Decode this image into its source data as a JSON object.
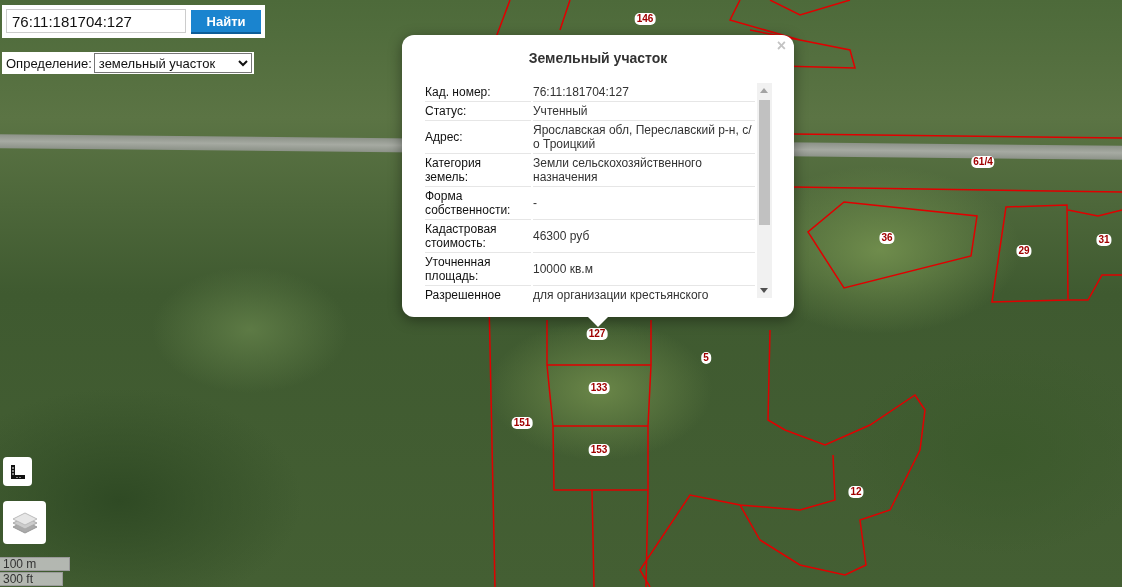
{
  "search": {
    "value": "76:11:181704:127",
    "button": "Найти"
  },
  "definition": {
    "label": "Определение:",
    "value": "земельный участок"
  },
  "popup": {
    "title": "Земельный участок",
    "close": "×",
    "rows": [
      {
        "label": "Кад. номер:",
        "value": "76:11:181704:127"
      },
      {
        "label": "Статус:",
        "value": "Учтенный"
      },
      {
        "label": "Адрес:",
        "value": "Ярославская обл, Переславский р-н, с/о Троицкий"
      },
      {
        "label": "Категория земель:",
        "value": "Земли сельскохозяйственного назначения"
      },
      {
        "label": "Форма собственности:",
        "value": "-"
      },
      {
        "label": "Кадастровая стоимость:",
        "value": "46300 руб"
      },
      {
        "label": "Уточненная площадь:",
        "value": "10000 кв.м"
      },
      {
        "label": "Разрешенное",
        "value": "для организации крестьянского"
      }
    ]
  },
  "parcel_labels": [
    {
      "text": "146"
    },
    {
      "text": "61/4"
    },
    {
      "text": "36"
    },
    {
      "text": "29"
    },
    {
      "text": "31"
    },
    {
      "text": "127"
    },
    {
      "text": "5"
    },
    {
      "text": "133"
    },
    {
      "text": "151"
    },
    {
      "text": "153"
    },
    {
      "text": "12"
    }
  ],
  "scale": [
    "100 m",
    "300 ft"
  ]
}
